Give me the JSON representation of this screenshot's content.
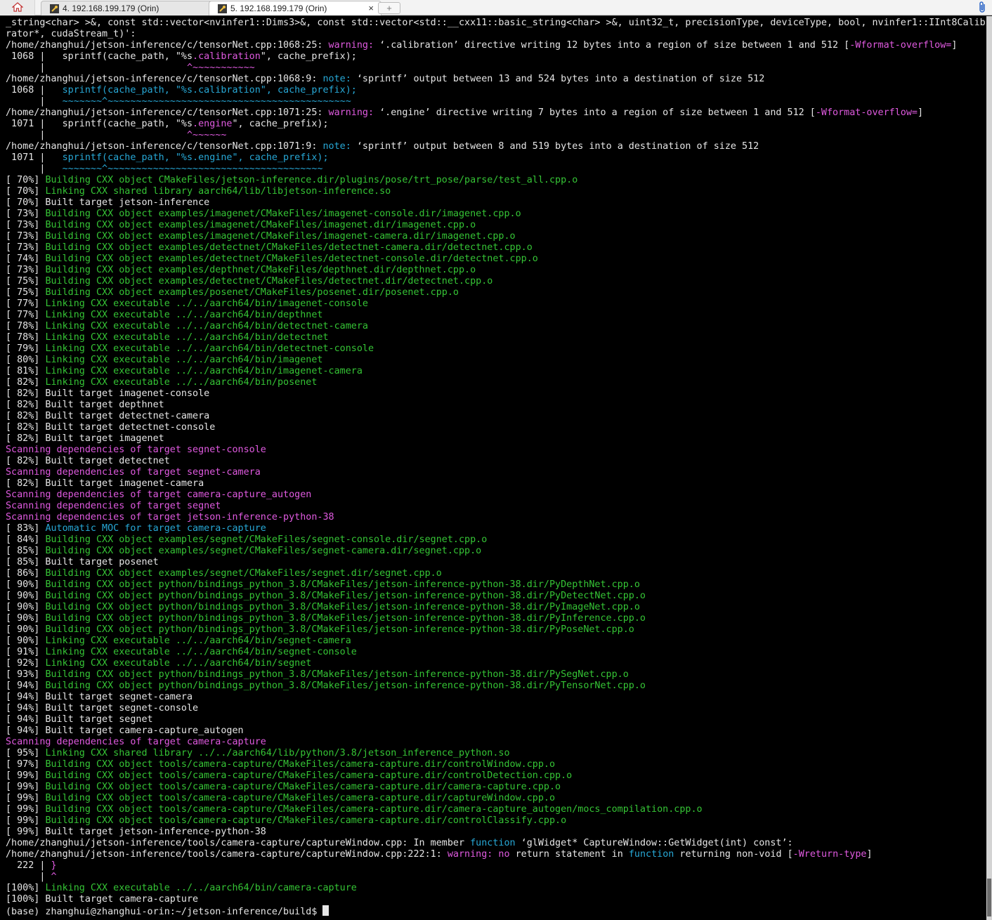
{
  "window": {
    "tabs": [
      {
        "label": "4. 192.168.199.179 (Orin)",
        "active": false
      },
      {
        "label": "5. 192.168.199.179 (Orin)",
        "active": true
      }
    ],
    "home_icon": "home-icon",
    "tab_icon": "wrench-icon",
    "close_label": "×",
    "new_tab_label": "+",
    "attachment_icon": "paperclip-icon"
  },
  "colors": {
    "background": "#000000",
    "text": "#e6e6e6",
    "warning": "#e05ae0",
    "note": "#27a8d6",
    "building": "#35c435",
    "linking": "#35c435",
    "scanning": "#e05ae0"
  },
  "terminal": {
    "lines": [
      [
        {
          "t": "_string<char> >&, const std::vector<nvinfer1::Dims3>&, const std::vector<std::__cxx11::basic_string<char> >&, uint32_t, precisionType, deviceType, bool, nvinfer1::IInt8Calib",
          "c": "white"
        }
      ],
      [
        {
          "t": "rator*, cudaStream_t)':",
          "c": "white"
        }
      ],
      [
        {
          "t": "/home/zhanghui/jetson-inference/c/tensorNet.cpp:1068:25: ",
          "c": "white"
        },
        {
          "t": "warning: ",
          "c": "magenta"
        },
        {
          "t": "‘.calibration’ directive writing 12 bytes into a region of size between 1 and 512 [",
          "c": "white"
        },
        {
          "t": "-Wformat-overflow=",
          "c": "magenta"
        },
        {
          "t": "]",
          "c": "white"
        }
      ],
      [
        {
          "t": " 1068 |   sprintf(cache_path, \"%s",
          "c": "white"
        },
        {
          "t": ".calibration",
          "c": "magenta"
        },
        {
          "t": "\", cache_prefix);",
          "c": "white"
        }
      ],
      [
        {
          "t": "      |                         ",
          "c": "white"
        },
        {
          "t": "^~~~~~~~~~~~",
          "c": "magenta"
        }
      ],
      [
        {
          "t": "/home/zhanghui/jetson-inference/c/tensorNet.cpp:1068:9: ",
          "c": "white"
        },
        {
          "t": "note: ",
          "c": "cyan"
        },
        {
          "t": "‘sprintf’ output between 13 and 524 bytes into a destination of size 512",
          "c": "white"
        }
      ],
      [
        {
          "t": " 1068 |   ",
          "c": "white"
        },
        {
          "t": "sprintf(cache_path, \"%s.calibration\", cache_prefix);",
          "c": "cyan"
        }
      ],
      [
        {
          "t": "      |   ",
          "c": "white"
        },
        {
          "t": "~~~~~~~^~~~~~~~~~~~~~~~~~~~~~~~~~~~~~~~~~~~~~~~~~~~",
          "c": "cyan"
        }
      ],
      [
        {
          "t": "/home/zhanghui/jetson-inference/c/tensorNet.cpp:1071:25: ",
          "c": "white"
        },
        {
          "t": "warning: ",
          "c": "magenta"
        },
        {
          "t": "‘.engine’ directive writing 7 bytes into a region of size between 1 and 512 [",
          "c": "white"
        },
        {
          "t": "-Wformat-overflow=",
          "c": "magenta"
        },
        {
          "t": "]",
          "c": "white"
        }
      ],
      [
        {
          "t": " 1071 |   sprintf(cache_path, \"%s",
          "c": "white"
        },
        {
          "t": ".engine",
          "c": "magenta"
        },
        {
          "t": "\", cache_prefix);",
          "c": "white"
        }
      ],
      [
        {
          "t": "      |                         ",
          "c": "white"
        },
        {
          "t": "^~~~~~~",
          "c": "magenta"
        }
      ],
      [
        {
          "t": "/home/zhanghui/jetson-inference/c/tensorNet.cpp:1071:9: ",
          "c": "white"
        },
        {
          "t": "note: ",
          "c": "cyan"
        },
        {
          "t": "‘sprintf’ output between 8 and 519 bytes into a destination of size 512",
          "c": "white"
        }
      ],
      [
        {
          "t": " 1071 |   ",
          "c": "white"
        },
        {
          "t": "sprintf(cache_path, \"%s.engine\", cache_prefix);",
          "c": "cyan"
        }
      ],
      [
        {
          "t": "      |   ",
          "c": "white"
        },
        {
          "t": "~~~~~~~^~~~~~~~~~~~~~~~~~~~~~~~~~~~~~~~~~~~~~~",
          "c": "cyan"
        }
      ],
      [
        {
          "t": "[ 70%] ",
          "c": "white"
        },
        {
          "t": "Building CXX object CMakeFiles/jetson-inference.dir/plugins/pose/trt_pose/parse/test_all.cpp.o",
          "c": "green"
        }
      ],
      [
        {
          "t": "[ 70%] ",
          "c": "white"
        },
        {
          "t": "Linking CXX shared library aarch64/lib/libjetson-inference.so",
          "c": "green"
        }
      ],
      [
        {
          "t": "[ 70%] Built target jetson-inference",
          "c": "white"
        }
      ],
      [
        {
          "t": "[ 73%] ",
          "c": "white"
        },
        {
          "t": "Building CXX object examples/imagenet/CMakeFiles/imagenet-console.dir/imagenet.cpp.o",
          "c": "green"
        }
      ],
      [
        {
          "t": "[ 73%] ",
          "c": "white"
        },
        {
          "t": "Building CXX object examples/imagenet/CMakeFiles/imagenet.dir/imagenet.cpp.o",
          "c": "green"
        }
      ],
      [
        {
          "t": "[ 73%] ",
          "c": "white"
        },
        {
          "t": "Building CXX object examples/imagenet/CMakeFiles/imagenet-camera.dir/imagenet.cpp.o",
          "c": "green"
        }
      ],
      [
        {
          "t": "[ 73%] ",
          "c": "white"
        },
        {
          "t": "Building CXX object examples/detectnet/CMakeFiles/detectnet-camera.dir/detectnet.cpp.o",
          "c": "green"
        }
      ],
      [
        {
          "t": "[ 74%] ",
          "c": "white"
        },
        {
          "t": "Building CXX object examples/detectnet/CMakeFiles/detectnet-console.dir/detectnet.cpp.o",
          "c": "green"
        }
      ],
      [
        {
          "t": "[ 73%] ",
          "c": "white"
        },
        {
          "t": "Building CXX object examples/depthnet/CMakeFiles/depthnet.dir/depthnet.cpp.o",
          "c": "green"
        }
      ],
      [
        {
          "t": "[ 75%] ",
          "c": "white"
        },
        {
          "t": "Building CXX object examples/detectnet/CMakeFiles/detectnet.dir/detectnet.cpp.o",
          "c": "green"
        }
      ],
      [
        {
          "t": "[ 75%] ",
          "c": "white"
        },
        {
          "t": "Building CXX object examples/posenet/CMakeFiles/posenet.dir/posenet.cpp.o",
          "c": "green"
        }
      ],
      [
        {
          "t": "[ 77%] ",
          "c": "white"
        },
        {
          "t": "Linking CXX executable ../../aarch64/bin/imagenet-console",
          "c": "green"
        }
      ],
      [
        {
          "t": "[ 77%] ",
          "c": "white"
        },
        {
          "t": "Linking CXX executable ../../aarch64/bin/depthnet",
          "c": "green"
        }
      ],
      [
        {
          "t": "[ 78%] ",
          "c": "white"
        },
        {
          "t": "Linking CXX executable ../../aarch64/bin/detectnet-camera",
          "c": "green"
        }
      ],
      [
        {
          "t": "[ 78%] ",
          "c": "white"
        },
        {
          "t": "Linking CXX executable ../../aarch64/bin/detectnet",
          "c": "green"
        }
      ],
      [
        {
          "t": "[ 79%] ",
          "c": "white"
        },
        {
          "t": "Linking CXX executable ../../aarch64/bin/detectnet-console",
          "c": "green"
        }
      ],
      [
        {
          "t": "[ 80%] ",
          "c": "white"
        },
        {
          "t": "Linking CXX executable ../../aarch64/bin/imagenet",
          "c": "green"
        }
      ],
      [
        {
          "t": "[ 81%] ",
          "c": "white"
        },
        {
          "t": "Linking CXX executable ../../aarch64/bin/imagenet-camera",
          "c": "green"
        }
      ],
      [
        {
          "t": "[ 82%] ",
          "c": "white"
        },
        {
          "t": "Linking CXX executable ../../aarch64/bin/posenet",
          "c": "green"
        }
      ],
      [
        {
          "t": "[ 82%] Built target imagenet-console",
          "c": "white"
        }
      ],
      [
        {
          "t": "[ 82%] Built target depthnet",
          "c": "white"
        }
      ],
      [
        {
          "t": "[ 82%] Built target detectnet-camera",
          "c": "white"
        }
      ],
      [
        {
          "t": "[ 82%] Built target detectnet-console",
          "c": "white"
        }
      ],
      [
        {
          "t": "[ 82%] Built target imagenet",
          "c": "white"
        }
      ],
      [
        {
          "t": "Scanning dependencies of target segnet-console",
          "c": "magenta"
        }
      ],
      [
        {
          "t": "[ 82%] Built target detectnet",
          "c": "white"
        }
      ],
      [
        {
          "t": "Scanning dependencies of target segnet-camera",
          "c": "magenta"
        }
      ],
      [
        {
          "t": "[ 82%] Built target imagenet-camera",
          "c": "white"
        }
      ],
      [
        {
          "t": "Scanning dependencies of target camera-capture_autogen",
          "c": "magenta"
        }
      ],
      [
        {
          "t": "Scanning dependencies of target segnet",
          "c": "magenta"
        }
      ],
      [
        {
          "t": "Scanning dependencies of target jetson-inference-python-38",
          "c": "magenta"
        }
      ],
      [
        {
          "t": "[ 83%] ",
          "c": "white"
        },
        {
          "t": "Automatic MOC for target camera-capture",
          "c": "cyan"
        }
      ],
      [
        {
          "t": "[ 84%] ",
          "c": "white"
        },
        {
          "t": "Building CXX object examples/segnet/CMakeFiles/segnet-console.dir/segnet.cpp.o",
          "c": "green"
        }
      ],
      [
        {
          "t": "[ 85%] ",
          "c": "white"
        },
        {
          "t": "Building CXX object examples/segnet/CMakeFiles/segnet-camera.dir/segnet.cpp.o",
          "c": "green"
        }
      ],
      [
        {
          "t": "[ 85%] Built target posenet",
          "c": "white"
        }
      ],
      [
        {
          "t": "[ 86%] ",
          "c": "white"
        },
        {
          "t": "Building CXX object examples/segnet/CMakeFiles/segnet.dir/segnet.cpp.o",
          "c": "green"
        }
      ],
      [
        {
          "t": "[ 90%] ",
          "c": "white"
        },
        {
          "t": "Building CXX object python/bindings_python_3.8/CMakeFiles/jetson-inference-python-38.dir/PyDepthNet.cpp.o",
          "c": "green"
        }
      ],
      [
        {
          "t": "[ 90%] ",
          "c": "white"
        },
        {
          "t": "Building CXX object python/bindings_python_3.8/CMakeFiles/jetson-inference-python-38.dir/PyDetectNet.cpp.o",
          "c": "green"
        }
      ],
      [
        {
          "t": "[ 90%] ",
          "c": "white"
        },
        {
          "t": "Building CXX object python/bindings_python_3.8/CMakeFiles/jetson-inference-python-38.dir/PyImageNet.cpp.o",
          "c": "green"
        }
      ],
      [
        {
          "t": "[ 90%] ",
          "c": "white"
        },
        {
          "t": "Building CXX object python/bindings_python_3.8/CMakeFiles/jetson-inference-python-38.dir/PyInference.cpp.o",
          "c": "green"
        }
      ],
      [
        {
          "t": "[ 90%] ",
          "c": "white"
        },
        {
          "t": "Building CXX object python/bindings_python_3.8/CMakeFiles/jetson-inference-python-38.dir/PyPoseNet.cpp.o",
          "c": "green"
        }
      ],
      [
        {
          "t": "[ 90%] ",
          "c": "white"
        },
        {
          "t": "Linking CXX executable ../../aarch64/bin/segnet-camera",
          "c": "green"
        }
      ],
      [
        {
          "t": "[ 91%] ",
          "c": "white"
        },
        {
          "t": "Linking CXX executable ../../aarch64/bin/segnet-console",
          "c": "green"
        }
      ],
      [
        {
          "t": "[ 92%] ",
          "c": "white"
        },
        {
          "t": "Linking CXX executable ../../aarch64/bin/segnet",
          "c": "green"
        }
      ],
      [
        {
          "t": "[ 93%] ",
          "c": "white"
        },
        {
          "t": "Building CXX object python/bindings_python_3.8/CMakeFiles/jetson-inference-python-38.dir/PySegNet.cpp.o",
          "c": "green"
        }
      ],
      [
        {
          "t": "[ 94%] ",
          "c": "white"
        },
        {
          "t": "Building CXX object python/bindings_python_3.8/CMakeFiles/jetson-inference-python-38.dir/PyTensorNet.cpp.o",
          "c": "green"
        }
      ],
      [
        {
          "t": "[ 94%] Built target segnet-camera",
          "c": "white"
        }
      ],
      [
        {
          "t": "[ 94%] Built target segnet-console",
          "c": "white"
        }
      ],
      [
        {
          "t": "[ 94%] Built target segnet",
          "c": "white"
        }
      ],
      [
        {
          "t": "[ 94%] Built target camera-capture_autogen",
          "c": "white"
        }
      ],
      [
        {
          "t": "Scanning dependencies of target camera-capture",
          "c": "magenta"
        }
      ],
      [
        {
          "t": "[ 95%] ",
          "c": "white"
        },
        {
          "t": "Linking CXX shared library ../../aarch64/lib/python/3.8/jetson_inference_python.so",
          "c": "green"
        }
      ],
      [
        {
          "t": "[ 97%] ",
          "c": "white"
        },
        {
          "t": "Building CXX object tools/camera-capture/CMakeFiles/camera-capture.dir/controlWindow.cpp.o",
          "c": "green"
        }
      ],
      [
        {
          "t": "[ 99%] ",
          "c": "white"
        },
        {
          "t": "Building CXX object tools/camera-capture/CMakeFiles/camera-capture.dir/controlDetection.cpp.o",
          "c": "green"
        }
      ],
      [
        {
          "t": "[ 99%] ",
          "c": "white"
        },
        {
          "t": "Building CXX object tools/camera-capture/CMakeFiles/camera-capture.dir/camera-capture.cpp.o",
          "c": "green"
        }
      ],
      [
        {
          "t": "[ 99%] ",
          "c": "white"
        },
        {
          "t": "Building CXX object tools/camera-capture/CMakeFiles/camera-capture.dir/captureWindow.cpp.o",
          "c": "green"
        }
      ],
      [
        {
          "t": "[ 99%] ",
          "c": "white"
        },
        {
          "t": "Building CXX object tools/camera-capture/CMakeFiles/camera-capture.dir/camera-capture_autogen/mocs_compilation.cpp.o",
          "c": "green"
        }
      ],
      [
        {
          "t": "[ 99%] ",
          "c": "white"
        },
        {
          "t": "Building CXX object tools/camera-capture/CMakeFiles/camera-capture.dir/controlClassify.cpp.o",
          "c": "green"
        }
      ],
      [
        {
          "t": "[ 99%] Built target jetson-inference-python-38",
          "c": "white"
        }
      ],
      [
        {
          "t": "/home/zhanghui/jetson-inference/tools/camera-capture/captureWindow.cpp: In member ",
          "c": "white"
        },
        {
          "t": "function",
          "c": "cyan"
        },
        {
          "t": " ‘glWidget* CaptureWindow::GetWidget(int) const’:",
          "c": "white"
        }
      ],
      [
        {
          "t": "/home/zhanghui/jetson-inference/tools/camera-capture/captureWindow.cpp:222:1: ",
          "c": "white"
        },
        {
          "t": "warning: ",
          "c": "magenta"
        },
        {
          "t": "no",
          "c": "magenta"
        },
        {
          "t": " return statement in ",
          "c": "white"
        },
        {
          "t": "function",
          "c": "cyan"
        },
        {
          "t": " returning non-void [",
          "c": "white"
        },
        {
          "t": "-Wreturn-type",
          "c": "magenta"
        },
        {
          "t": "]",
          "c": "white"
        }
      ],
      [
        {
          "t": "  222 | ",
          "c": "white"
        },
        {
          "t": "}",
          "c": "magenta"
        }
      ],
      [
        {
          "t": "      | ",
          "c": "white"
        },
        {
          "t": "^",
          "c": "magenta"
        }
      ],
      [
        {
          "t": "[100%] ",
          "c": "white"
        },
        {
          "t": "Linking CXX executable ../../aarch64/bin/camera-capture",
          "c": "green"
        }
      ],
      [
        {
          "t": "[100%] Built target camera-capture",
          "c": "white"
        }
      ],
      [
        {
          "t": "(base) zhanghui@zhanghui-orin:~/jetson-inference/build$ ",
          "c": "white"
        }
      ]
    ]
  }
}
